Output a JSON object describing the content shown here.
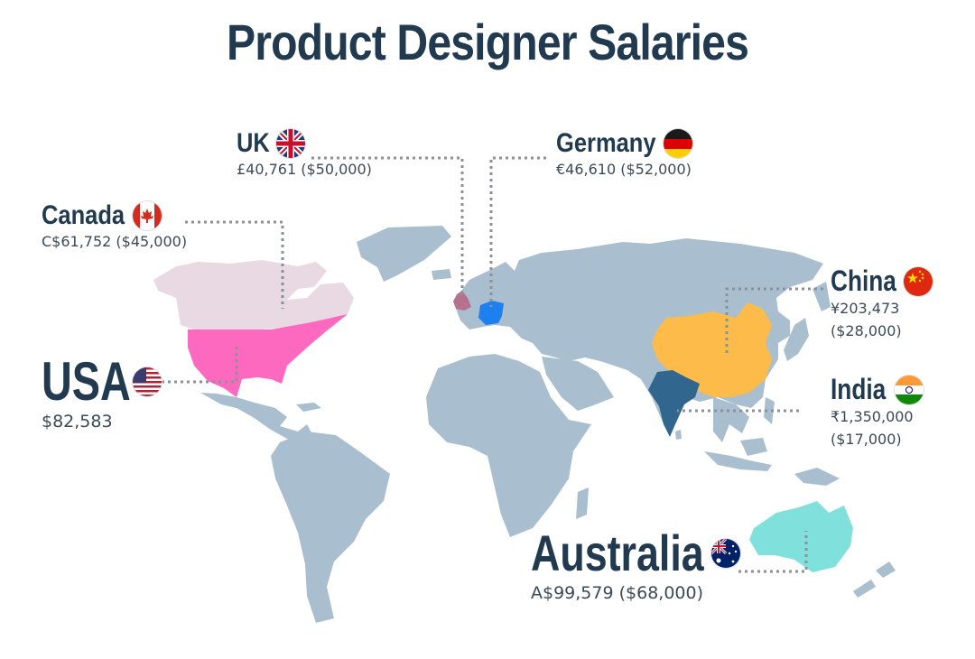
{
  "title": "Product Designer Salaries",
  "colors": {
    "land": "#a9bece",
    "text": "#223a4f",
    "leader": "#8a9199",
    "usa": "#fd69be",
    "canada": "#e8d9e3",
    "uk": "#b5728f",
    "germany": "#1e80ee",
    "china": "#fdbc49",
    "india": "#31678f",
    "australia": "#80e0db"
  },
  "countries": {
    "uk": {
      "name": "UK",
      "salary": "£40,761 ($50,000)",
      "flag": "uk-flag-icon"
    },
    "germany": {
      "name": "Germany",
      "salary": "€46,610 ($52,000)",
      "flag": "germany-flag-icon"
    },
    "canada": {
      "name": "Canada",
      "salary": "C$61,752 ($45,000)",
      "flag": "canada-flag-icon"
    },
    "usa": {
      "name": "USA",
      "salary": "$82,583",
      "flag": "usa-flag-icon"
    },
    "china": {
      "name": "China",
      "salary_line1": "¥203,473",
      "salary_line2": "($28,000)",
      "flag": "china-flag-icon"
    },
    "india": {
      "name": "India",
      "salary_line1": "₹1,350,000",
      "salary_line2": "($17,000)",
      "flag": "india-flag-icon"
    },
    "australia": {
      "name": "Australia",
      "salary": "A$99,579 ($68,000)",
      "flag": "australia-flag-icon"
    }
  }
}
